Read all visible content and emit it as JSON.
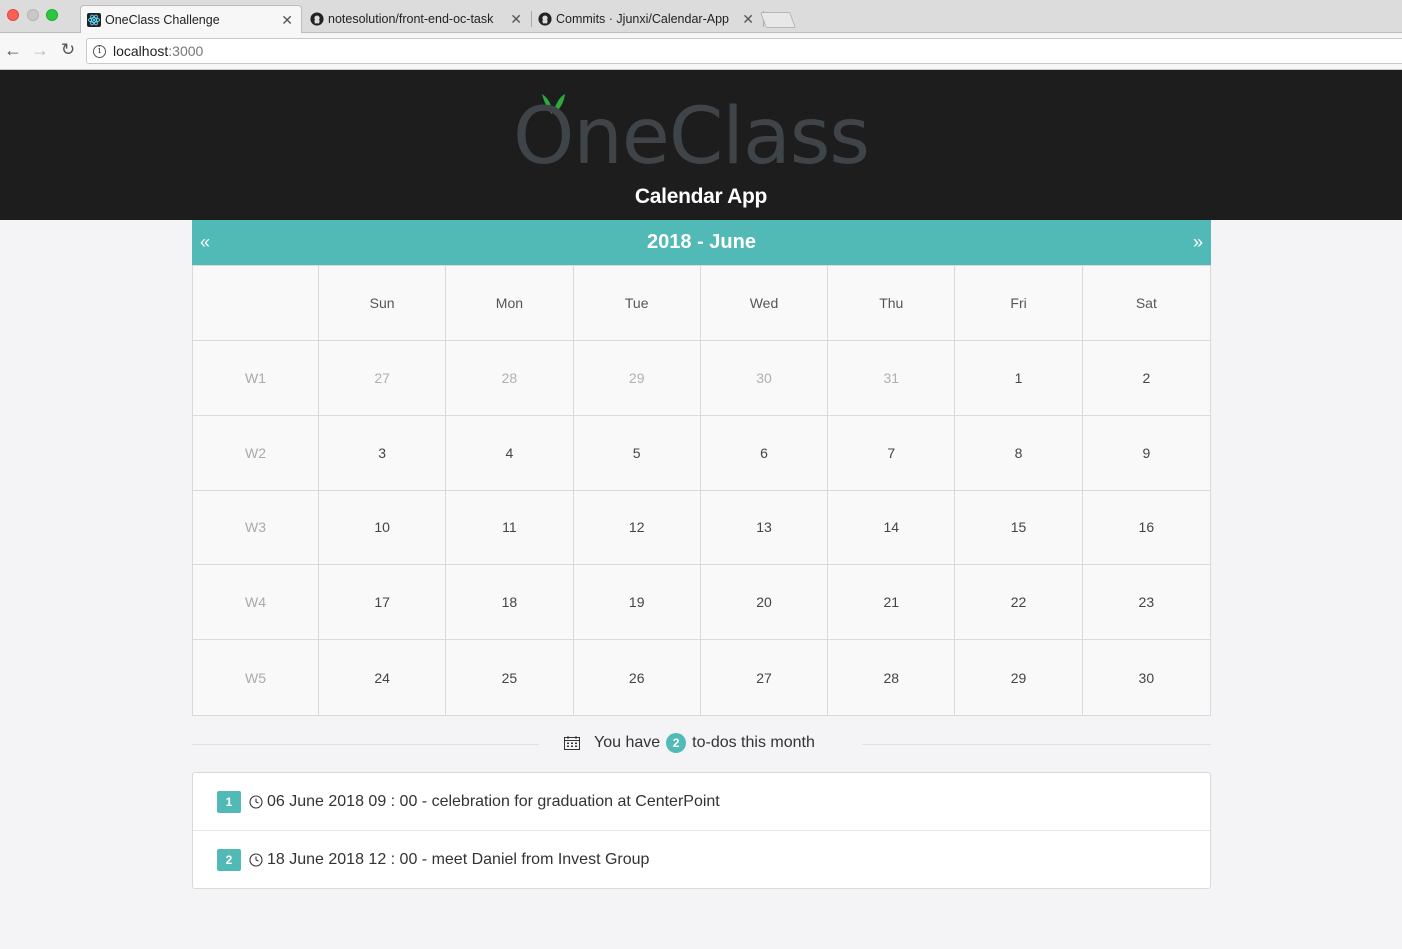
{
  "browser": {
    "tabs": [
      {
        "title": "OneClass Challenge"
      },
      {
        "title": "notesolution/front-end-oc-task"
      },
      {
        "title": "Commits · Jjunxi/Calendar-App"
      }
    ],
    "url_host": "localhost",
    "url_port": ":3000"
  },
  "header": {
    "logo_text": "OneClass",
    "app_title": "Calendar App"
  },
  "calendar": {
    "title": "2018 - June",
    "prev_label": "«",
    "next_label": "»",
    "day_names": [
      "Sun",
      "Mon",
      "Tue",
      "Wed",
      "Thu",
      "Fri",
      "Sat"
    ],
    "weeks": [
      {
        "label": "W1",
        "days": [
          {
            "d": "27",
            "other": true
          },
          {
            "d": "28",
            "other": true
          },
          {
            "d": "29",
            "other": true
          },
          {
            "d": "30",
            "other": true
          },
          {
            "d": "31",
            "other": true
          },
          {
            "d": "1"
          },
          {
            "d": "2"
          }
        ]
      },
      {
        "label": "W2",
        "days": [
          {
            "d": "3"
          },
          {
            "d": "4"
          },
          {
            "d": "5"
          },
          {
            "d": "6"
          },
          {
            "d": "7"
          },
          {
            "d": "8"
          },
          {
            "d": "9"
          }
        ]
      },
      {
        "label": "W3",
        "days": [
          {
            "d": "10"
          },
          {
            "d": "11"
          },
          {
            "d": "12"
          },
          {
            "d": "13"
          },
          {
            "d": "14"
          },
          {
            "d": "15"
          },
          {
            "d": "16"
          }
        ]
      },
      {
        "label": "W4",
        "days": [
          {
            "d": "17"
          },
          {
            "d": "18"
          },
          {
            "d": "19"
          },
          {
            "d": "20"
          },
          {
            "d": "21"
          },
          {
            "d": "22"
          },
          {
            "d": "23"
          }
        ]
      },
      {
        "label": "W5",
        "days": [
          {
            "d": "24"
          },
          {
            "d": "25"
          },
          {
            "d": "26"
          },
          {
            "d": "27"
          },
          {
            "d": "28"
          },
          {
            "d": "29"
          },
          {
            "d": "30"
          }
        ]
      }
    ]
  },
  "todos_summary": {
    "prefix": "You have",
    "count": "2",
    "suffix": "to-dos this month"
  },
  "todos": [
    {
      "num": "1",
      "text": "06 June 2018 09 : 00 - celebration for graduation at CenterPoint"
    },
    {
      "num": "2",
      "text": "18 June 2018 12 : 00 - meet Daniel from Invest Group"
    }
  ],
  "colors": {
    "accent": "#52bab6",
    "header_bg": "#1d1d1d",
    "leaf": "#2eaa3c"
  }
}
